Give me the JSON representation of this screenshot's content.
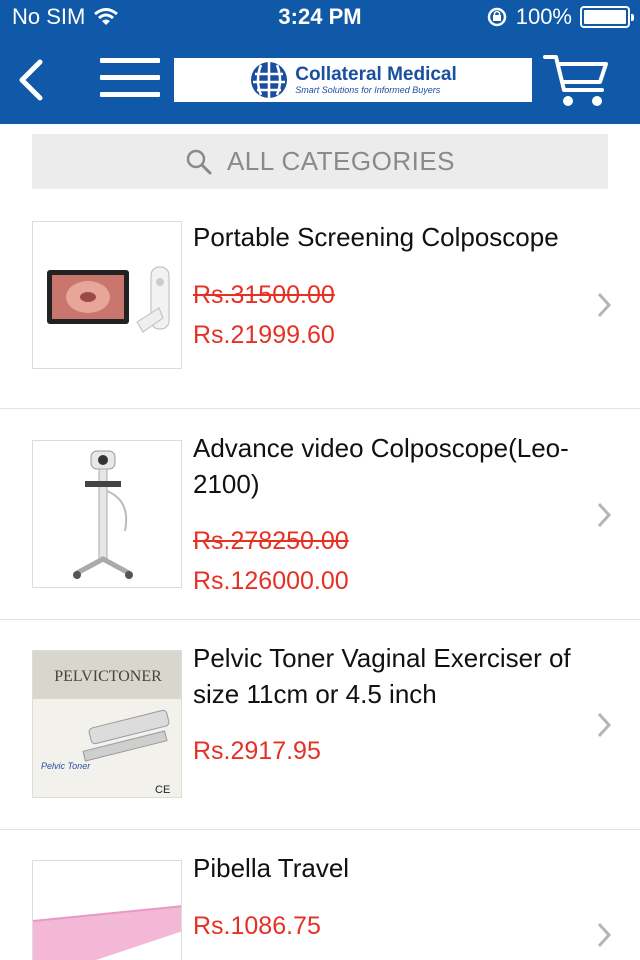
{
  "status_bar": {
    "carrier": "No SIM",
    "time": "3:24 PM",
    "battery": "100%"
  },
  "header": {
    "logo_title": "Collateral Medical",
    "logo_tagline": "Smart Solutions for Informed Buyers"
  },
  "search": {
    "label": "ALL CATEGORIES"
  },
  "products": [
    {
      "title": "Portable Screening Colposcope",
      "old_price": "Rs.31500.00",
      "price": "Rs.21999.60"
    },
    {
      "title": "Advance video Colposcope(Leo-2100)",
      "old_price": "Rs.278250.00",
      "price": "Rs.126000.00"
    },
    {
      "title": "Pelvic Toner Vaginal Exerciser of size 11cm or 4.5 inch",
      "price": "Rs.2917.95",
      "image_text": "PELVICTONER",
      "image_brand": "Pelvic Toner",
      "image_mark": "CE"
    },
    {
      "title": "Pibella Travel",
      "price": "Rs.1086.75"
    }
  ],
  "colors": {
    "header": "#1059a8",
    "price": "#e53124",
    "search_bg": "#ececec"
  }
}
